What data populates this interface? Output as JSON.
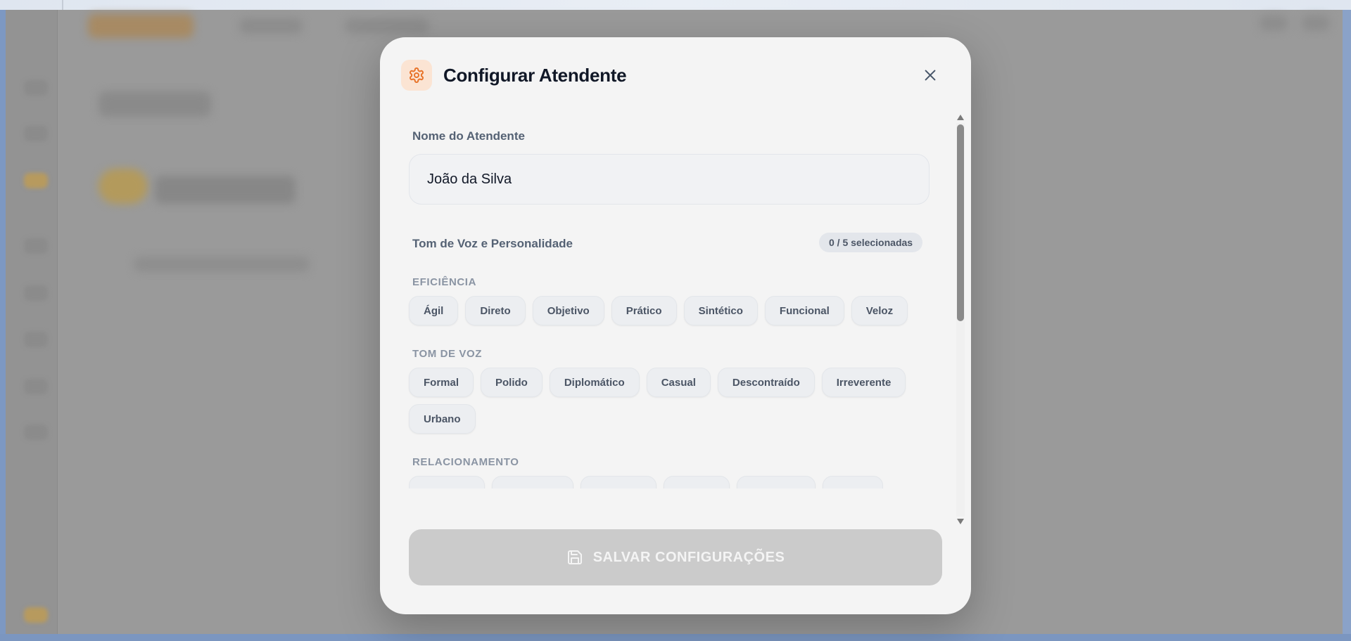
{
  "modal": {
    "title": "Configurar Atendente",
    "name_label": "Nome do Atendente",
    "name_value": "João da Silva",
    "tone_label": "Tom de Voz e Personalidade",
    "selection_counter": "0 / 5 selecionadas",
    "save_label": "SALVAR CONFIGURAÇÕES"
  },
  "groups": [
    {
      "label": "EFICIÊNCIA",
      "chips": [
        "Ágil",
        "Direto",
        "Objetivo",
        "Prático",
        "Sintético",
        "Funcional",
        "Veloz"
      ]
    },
    {
      "label": "TOM DE VOZ",
      "chips": [
        "Formal",
        "Polido",
        "Diplomático",
        "Casual",
        "Descontraído",
        "Irreverente",
        "Urbano"
      ]
    },
    {
      "label": "RELACIONAMENTO",
      "chips": []
    }
  ],
  "colors": {
    "accent": "#e8742a",
    "accent_bg": "#fbe4d3",
    "save_disabled": "#cbcbcb"
  },
  "icons": {
    "header": "gear-icon",
    "close": "close-icon",
    "save": "floppy-disk-icon"
  }
}
